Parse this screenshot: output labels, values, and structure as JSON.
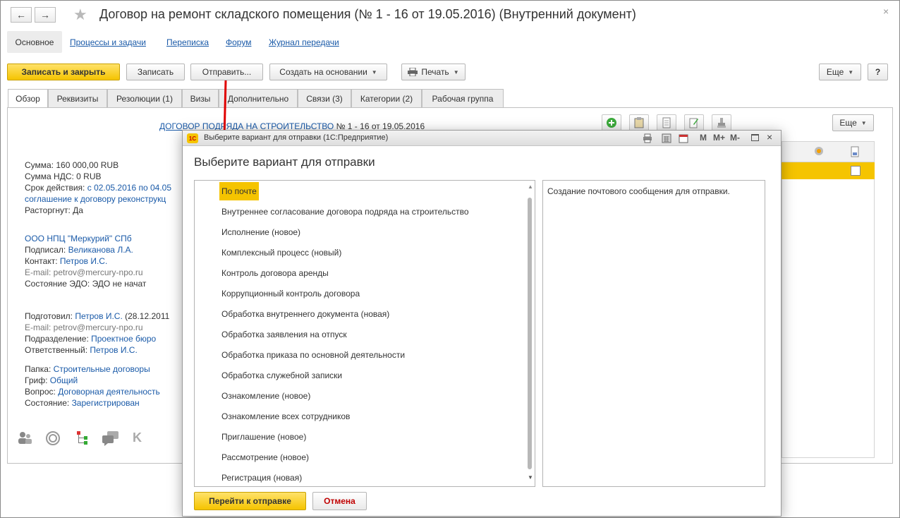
{
  "window": {
    "title": "Договор на ремонт складского помещения (№ 1 - 16 от 19.05.2016) (Внутренний документ)",
    "back_icon": "←",
    "forward_icon": "→",
    "close_icon": "×"
  },
  "topnav": {
    "active": "Основное",
    "links": [
      "Процессы и задачи",
      "Переписка",
      "Форум",
      "Журнал передачи"
    ]
  },
  "toolbar": {
    "save_close": "Записать и закрыть",
    "save": "Записать",
    "send": "Отправить...",
    "create_based": "Создать на основании",
    "print": "Печать",
    "more": "Еще",
    "help": "?"
  },
  "tabs": [
    "Обзор",
    "Реквизиты",
    "Резолюции (1)",
    "Визы",
    "Дополнительно",
    "Связи (3)",
    "Категории (2)",
    "Рабочая группа"
  ],
  "overview": {
    "contract_link": "ДОГОВОР ПОДРЯДА НА СТРОИТЕЛЬСТВО",
    "contract_number": "№ 1 - 16 от 19.05.2016",
    "sum": "Сумма: 160 000,00 RUB",
    "vat": "Сумма НДС: 0 RUB",
    "term_label": "Срок действия:",
    "term_value": "с 02.05.2016 по 04.05",
    "term_line2": "соглашение к договору реконструкц",
    "terminated": "Расторгнут: Да",
    "org": "ООО НПЦ \"Меркурий\" СПб",
    "signed_label": "Подписал:",
    "signed_value": "Великанова Л.А.",
    "contact_label": "Контакт:",
    "contact_value": "Петров И.С.",
    "email1": "E-mail:  petrov@mercury-npo.ru",
    "edo": "Состояние ЭДО: ЭДО не начат",
    "prepared_label": "Подготовил:",
    "prepared_value": "Петров И.С.",
    "prepared_date": "(28.12.2011",
    "email2": "E-mail:  petrov@mercury-npo.ru",
    "dept_label": "Подразделение:",
    "dept_value": "Проектное бюро",
    "resp_label": "Ответственный:",
    "resp_value": "Петров И.С.",
    "folder_label": "Папка:",
    "folder_value": "Строительные договоры",
    "grif_label": "Гриф:",
    "grif_value": "Общий",
    "question_label": "Вопрос:",
    "question_value": "Договорная деятельность",
    "state_label": "Состояние:",
    "state_value": "Зарегистрирован"
  },
  "right_panel": {
    "more": "Еще"
  },
  "modal": {
    "titlebar": "Выберите вариант для отправки  (1С:Предприятие)",
    "heading": "Выберите вариант для отправки",
    "toolbar_m": "M",
    "toolbar_mplus": "M+",
    "toolbar_mminus": "M-",
    "items": [
      "По почте",
      "Внутреннее согласование договора подряда на строительство",
      "Исполнение (новое)",
      "Комплексный процесс (новый)",
      "Контроль договора аренды",
      "Коррупционный контроль договора",
      "Обработка внутреннего документа (новая)",
      "Обработка заявления на отпуск",
      "Обработка приказа по основной деятельности",
      "Обработка служебной записки",
      "Ознакомление (новое)",
      "Ознакомление всех сотрудников",
      "Приглашение (новое)",
      "Рассмотрение (новое)",
      "Регистрация (новая)"
    ],
    "selected_index": 0,
    "description": "Создание почтового сообщения для отправки.",
    "go_button": "Перейти к отправке",
    "cancel_button": "Отмена"
  },
  "colors": {
    "accent_yellow": "#f5c400",
    "link_blue": "#1a5aa8",
    "cancel_red": "#c00000",
    "arrow_red": "#e00000"
  }
}
